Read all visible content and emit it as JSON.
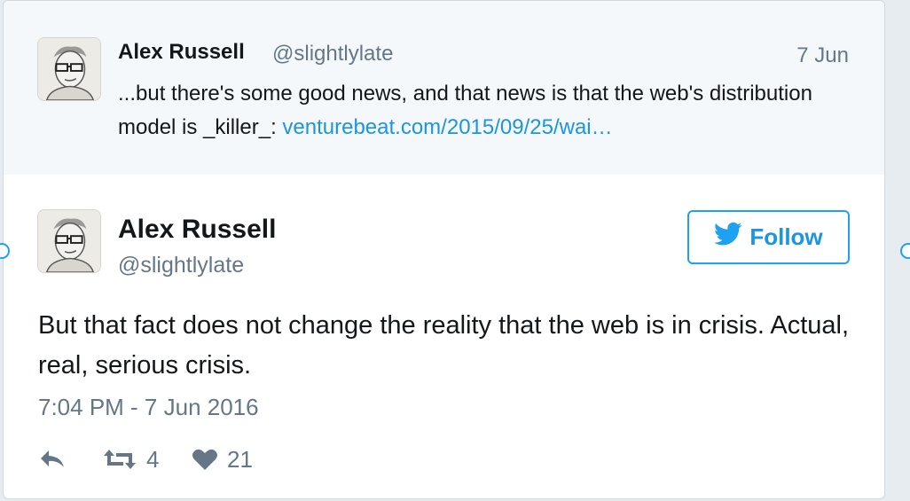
{
  "parent_tweet": {
    "author_name": "Alex Russell",
    "author_handle": "@slightlylate",
    "date": "7 Jun",
    "text": "...but there's some good news, and that news is that the web's distribution model is _killer_: ",
    "link_text": "venturebeat.com/2015/09/25/wai…"
  },
  "main_tweet": {
    "author_name": "Alex Russell",
    "author_handle": "@slightlylate",
    "follow_label": "Follow",
    "text": "But that fact does not change the reality that the web is in crisis. Actual, real, serious crisis.",
    "timestamp": "7:04 PM - 7 Jun 2016",
    "retweet_count": "4",
    "like_count": "21"
  },
  "colors": {
    "accent": "#1da1f2",
    "link": "#1b95e0",
    "muted_text": "#657786",
    "parent_background": "#f5f8fa"
  },
  "icons": {
    "follow": "twitter-bird-icon",
    "reply": "reply-arrow-icon",
    "retweet": "retweet-icon",
    "like": "heart-icon"
  }
}
